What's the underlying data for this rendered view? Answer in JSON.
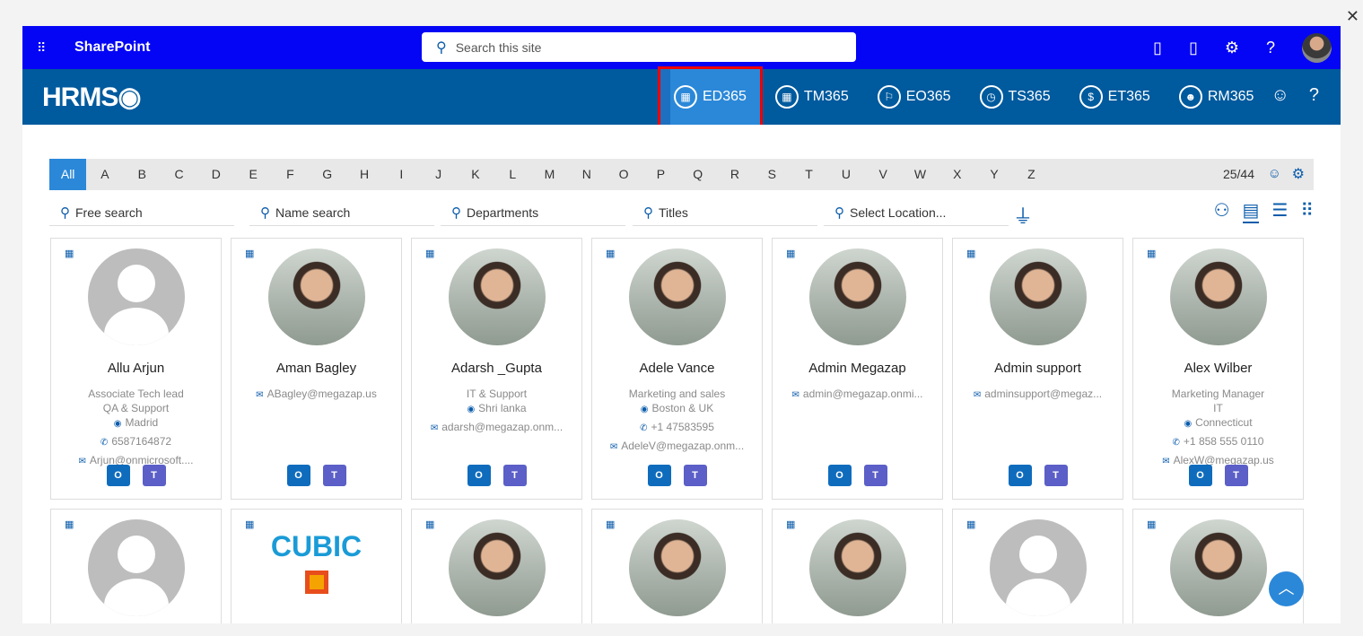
{
  "topbar": {
    "app_name": "SharePoint",
    "search_placeholder": "Search this site",
    "settings_icon": "gear-icon",
    "help": "?"
  },
  "hrms": {
    "logo": "HRMS",
    "apps": [
      {
        "label": "ED365",
        "icon": "contacts-icon",
        "active": true
      },
      {
        "label": "TM365",
        "icon": "calendar-icon"
      },
      {
        "label": "EO365",
        "icon": "onboarding-icon"
      },
      {
        "label": "TS365",
        "icon": "clock-icon"
      },
      {
        "label": "ET365",
        "icon": "expense-icon"
      },
      {
        "label": "RM365",
        "icon": "person-icon"
      }
    ],
    "help": "?"
  },
  "alphabet": {
    "letters": [
      "All",
      "A",
      "B",
      "C",
      "D",
      "E",
      "F",
      "G",
      "H",
      "I",
      "J",
      "K",
      "L",
      "M",
      "N",
      "O",
      "P",
      "Q",
      "R",
      "S",
      "T",
      "U",
      "V",
      "W",
      "X",
      "Y",
      "Z"
    ],
    "count": "25/44"
  },
  "filters": {
    "free": "Free search",
    "name": "Name search",
    "departments": "Departments",
    "titles": "Titles",
    "location": "Select Location..."
  },
  "employees": [
    {
      "name": "Allu Arjun",
      "lines": [
        "Associate Tech lead",
        "QA & Support"
      ],
      "location": "Madrid",
      "phone": "6587164872",
      "email": "Arjun@onmicrosoft....",
      "photo": "placeholder"
    },
    {
      "name": "Aman Bagley",
      "lines": [],
      "email": "ABagley@megazap.us",
      "photo": "photo"
    },
    {
      "name": "Adarsh _Gupta",
      "lines": [
        "IT & Support"
      ],
      "location": "Shri lanka",
      "email": "adarsh@megazap.onm...",
      "photo": "photo"
    },
    {
      "name": "Adele Vance",
      "lines": [
        "Marketing and sales"
      ],
      "location": "Boston & UK",
      "phone": "+1 47583595",
      "email": "AdeleV@megazap.onm...",
      "photo": "photo"
    },
    {
      "name": "Admin Megazap",
      "lines": [],
      "email": "admin@megazap.onmi...",
      "photo": "photo"
    },
    {
      "name": "Admin support",
      "lines": [],
      "email": "adminsupport@megaz...",
      "photo": "photo"
    },
    {
      "name": "Alex Wilber",
      "lines": [
        "Marketing Manager",
        "IT"
      ],
      "location": "Connecticut",
      "phone": "+1 858 555 0110",
      "email": "AlexW@megazap.us",
      "photo": "photo"
    },
    {
      "photo": "placeholder"
    },
    {
      "photo": "cubic",
      "logo_text": "CUBIC"
    },
    {
      "photo": "photo"
    },
    {
      "photo": "photo"
    },
    {
      "photo": "photo"
    },
    {
      "photo": "placeholder"
    },
    {
      "photo": "photo"
    }
  ]
}
